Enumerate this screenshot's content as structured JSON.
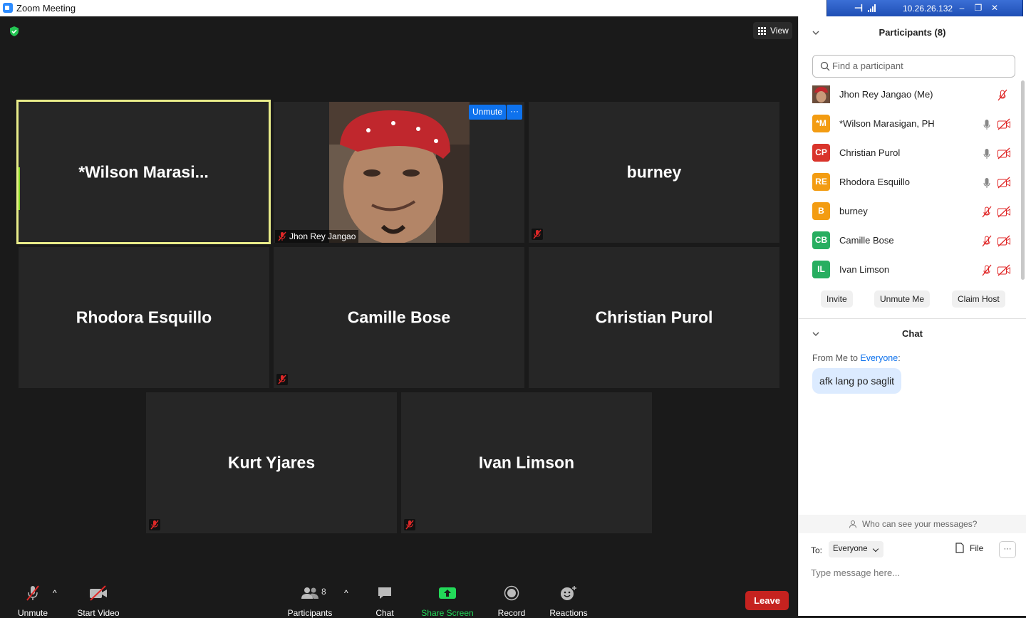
{
  "window": {
    "title": "Zoom Meeting"
  },
  "remote_bar": {
    "ip": "10.26.26.132"
  },
  "top": {
    "view_label": "View"
  },
  "my_video": {
    "name": "Jhon Rey Jangao",
    "unmute_label": "Unmute",
    "more_label": "···"
  },
  "tiles": [
    {
      "name": "*Wilson  Marasi...",
      "active": true
    },
    {
      "name": "burney"
    },
    {
      "name": "Rhodora Esquillo"
    },
    {
      "name": "Camille Bose"
    },
    {
      "name": "Christian Purol"
    },
    {
      "name": "Kurt Yjares"
    },
    {
      "name": "Ivan Limson"
    }
  ],
  "toolbar": {
    "unmute": "Unmute",
    "start_video": "Start Video",
    "participants": "Participants",
    "participants_count": "8",
    "chat": "Chat",
    "share_screen": "Share Screen",
    "record": "Record",
    "reactions": "Reactions",
    "leave": "Leave"
  },
  "participants_panel": {
    "title": "Participants (8)",
    "search_placeholder": "Find a participant",
    "rows": [
      {
        "initials": "",
        "name": "Jhon Rey Jangao (Me)",
        "color": "#8a5a44",
        "mic": "muted",
        "cam": "none"
      },
      {
        "initials": "*M",
        "name": "*Wilson Marasigan, PH",
        "color": "#f39c12",
        "mic": "on",
        "cam": "off"
      },
      {
        "initials": "CP",
        "name": "Christian Purol",
        "color": "#d9342b",
        "mic": "on",
        "cam": "off"
      },
      {
        "initials": "RE",
        "name": "Rhodora Esquillo",
        "color": "#f39c12",
        "mic": "on",
        "cam": "off"
      },
      {
        "initials": "B",
        "name": "burney",
        "color": "#f39c12",
        "mic": "muted",
        "cam": "off"
      },
      {
        "initials": "CB",
        "name": "Camille Bose",
        "color": "#27ae60",
        "mic": "muted",
        "cam": "off"
      },
      {
        "initials": "IL",
        "name": "Ivan Limson",
        "color": "#27ae60",
        "mic": "muted",
        "cam": "off"
      }
    ],
    "buttons": {
      "invite": "Invite",
      "unmute_me": "Unmute Me",
      "claim_host": "Claim Host"
    }
  },
  "chat_panel": {
    "title": "Chat",
    "from_prefix": "From Me to ",
    "from_target": "Everyone",
    "from_suffix": ":",
    "message": "afk lang po saglit",
    "who_can_see": "Who can see your messages?",
    "to_label": "To:",
    "to_value": "Everyone",
    "file_label": "File",
    "more_label": "···",
    "input_placeholder": "Type message here..."
  },
  "colors": {
    "accent": "#0e72ed",
    "leave": "#c5221f",
    "share": "#23d959",
    "active_border": "#e9ec8a"
  }
}
